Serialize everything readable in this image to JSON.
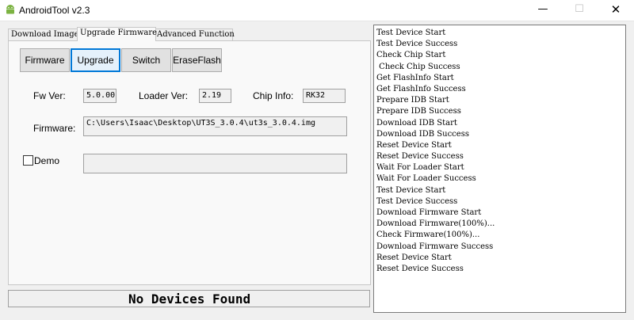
{
  "window": {
    "title": "AndroidTool v2.3"
  },
  "tabs": [
    "Download Image",
    "Upgrade Firmware",
    "Advanced Function"
  ],
  "buttons": {
    "firmware": "Firmware",
    "upgrade": "Upgrade",
    "switch": "Switch",
    "erase_flash": "EraseFlash"
  },
  "info": {
    "fw_ver_label": "Fw Ver:",
    "fw_ver_value": "5.0.00",
    "loader_ver_label": "Loader Ver:",
    "loader_ver_value": "2.19",
    "chip_info_label": "Chip Info:",
    "chip_info_value": "RK32",
    "firmware_label": "Firmware:",
    "firmware_path": "C:\\Users\\Isaac\\Desktop\\UT3S_3.0.4\\ut3s_3.0.4.img",
    "demo_label": "Demo",
    "demo_checked": false,
    "demo_path": ""
  },
  "status": "No Devices Found",
  "log": [
    "Test Device Start",
    "Test Device Success",
    "Check Chip Start",
    " Check Chip Success",
    "Get FlashInfo Start",
    "Get FlashInfo Success",
    "Prepare IDB Start",
    "Prepare IDB Success",
    "Download IDB Start",
    "Download IDB Success",
    "Reset Device Start",
    "Reset Device Success",
    "Wait For Loader Start",
    "Wait For Loader Success",
    "Test Device Start",
    "Test Device Success",
    "Download Firmware Start",
    "Download Firmware(100%)...",
    "Check Firmware(100%)...",
    "Download Firmware Success",
    "Reset Device Start",
    "Reset Device Success"
  ]
}
